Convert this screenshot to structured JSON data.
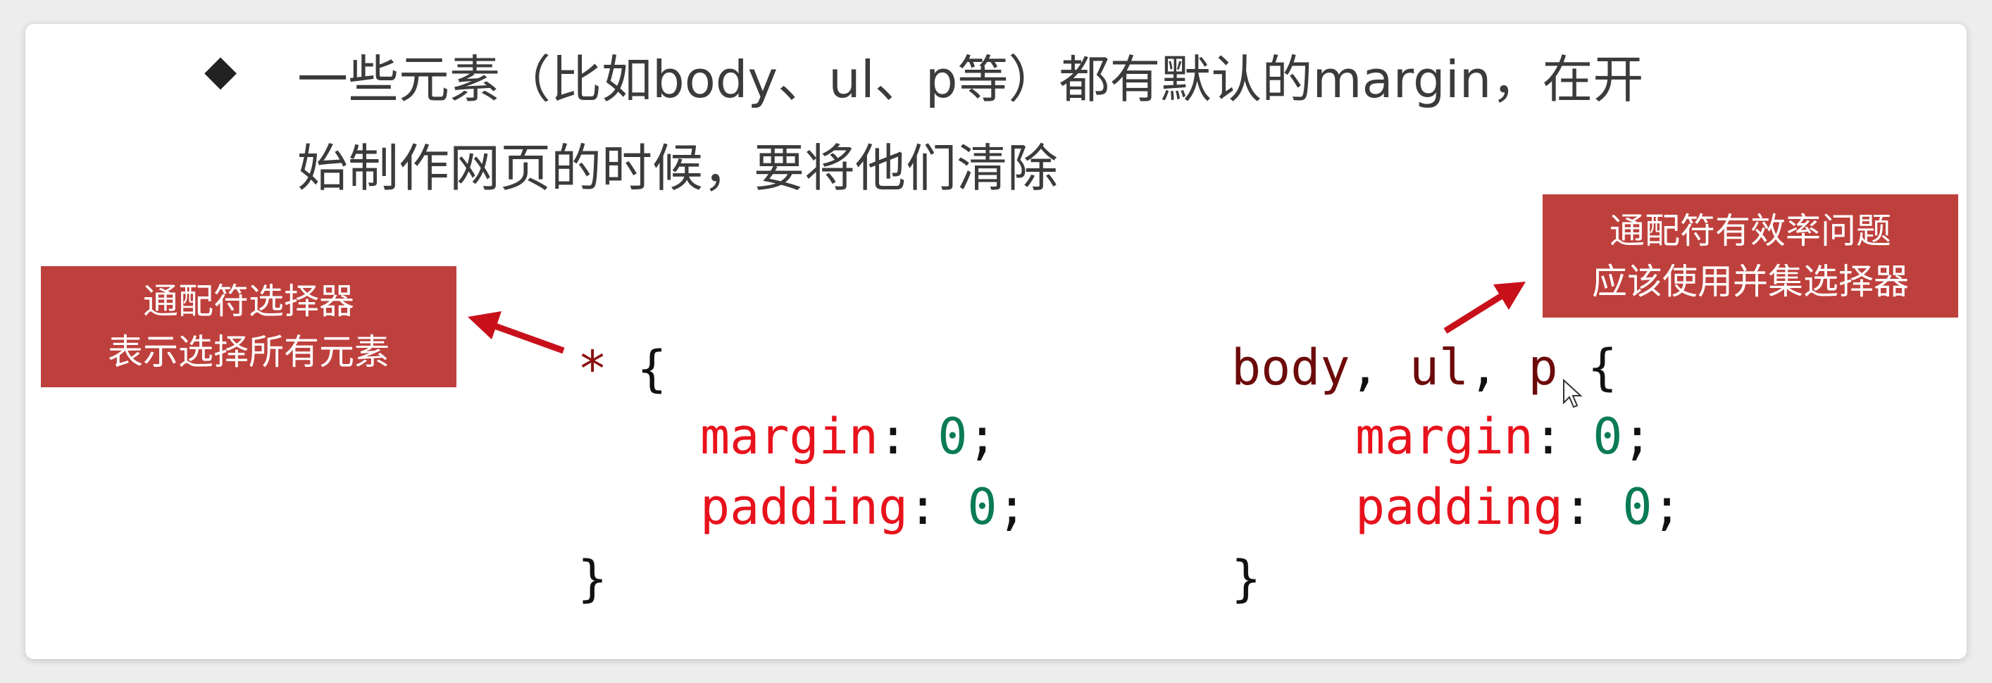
{
  "heading": {
    "bullet_symbol": "◆",
    "line1": "一些元素（比如body、ul、p等）都有默认的margin，在开",
    "line2": "始制作网页的时候，要将他们清除"
  },
  "callouts": {
    "left": {
      "line1": "通配符选择器",
      "line2": "表示选择所有元素"
    },
    "right": {
      "line1": "通配符有效率问题",
      "line2": "应该使用并集选择器"
    }
  },
  "code_left": {
    "selector": "*",
    "open_brace": "{",
    "rules": [
      {
        "property": "margin",
        "colon": ":",
        "value": "0",
        "semicolon": ";"
      },
      {
        "property": "padding",
        "colon": ":",
        "value": "0",
        "semicolon": ";"
      }
    ],
    "close_brace": "}"
  },
  "code_right": {
    "selector_body": "body",
    "separator1": ",",
    "selector_ul": "ul",
    "separator2": ",",
    "selector_p": "p",
    "open_brace": "{",
    "rules": [
      {
        "property": "margin",
        "colon": ":",
        "value": "0",
        "semicolon": ";"
      },
      {
        "property": "padding",
        "colon": ":",
        "value": "0",
        "semicolon": ";"
      }
    ],
    "close_brace": "}"
  },
  "colors": {
    "callout_bg": "#be403c",
    "arrow": "#c8101a",
    "property": "#e8121c",
    "value": "#0a7b55",
    "selector": "#6d0a0a"
  },
  "icons": {
    "arrow_left": "arrow-left-icon",
    "arrow_right": "arrow-up-right-icon",
    "cursor": "mouse-pointer-icon"
  }
}
